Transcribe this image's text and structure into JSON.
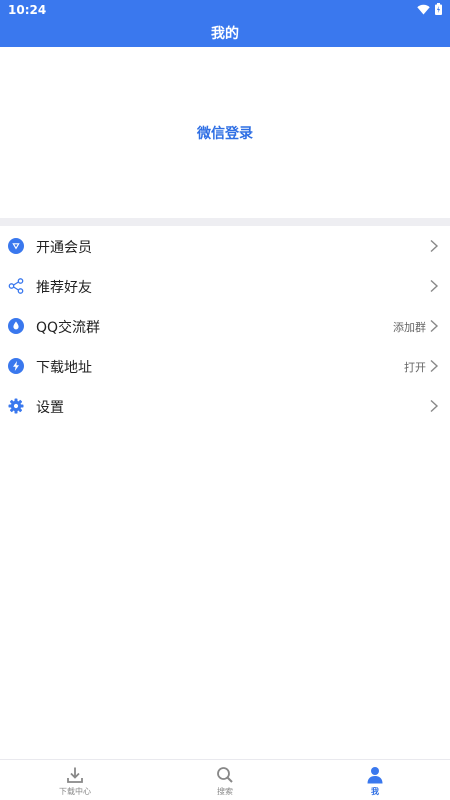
{
  "status_bar": {
    "time": "10:24"
  },
  "header": {
    "title": "我的"
  },
  "login": {
    "label": "微信登录"
  },
  "menu": [
    {
      "label": "开通会员",
      "value": "",
      "icon": "vip-icon"
    },
    {
      "label": "推荐好友",
      "value": "",
      "icon": "share-icon"
    },
    {
      "label": "QQ交流群",
      "value": "添加群",
      "icon": "qq-icon"
    },
    {
      "label": "下载地址",
      "value": "打开",
      "icon": "lightning-icon"
    },
    {
      "label": "设置",
      "value": "",
      "icon": "gear-icon"
    }
  ],
  "bottom_nav": [
    {
      "label": "下载中心",
      "icon": "download-icon"
    },
    {
      "label": "搜索",
      "icon": "search-icon"
    },
    {
      "label": "我",
      "icon": "user-icon",
      "active": true
    }
  ],
  "colors": {
    "primary": "#3a78ee",
    "accent_text": "#2f6fe4",
    "divider": "#eeeef2"
  }
}
